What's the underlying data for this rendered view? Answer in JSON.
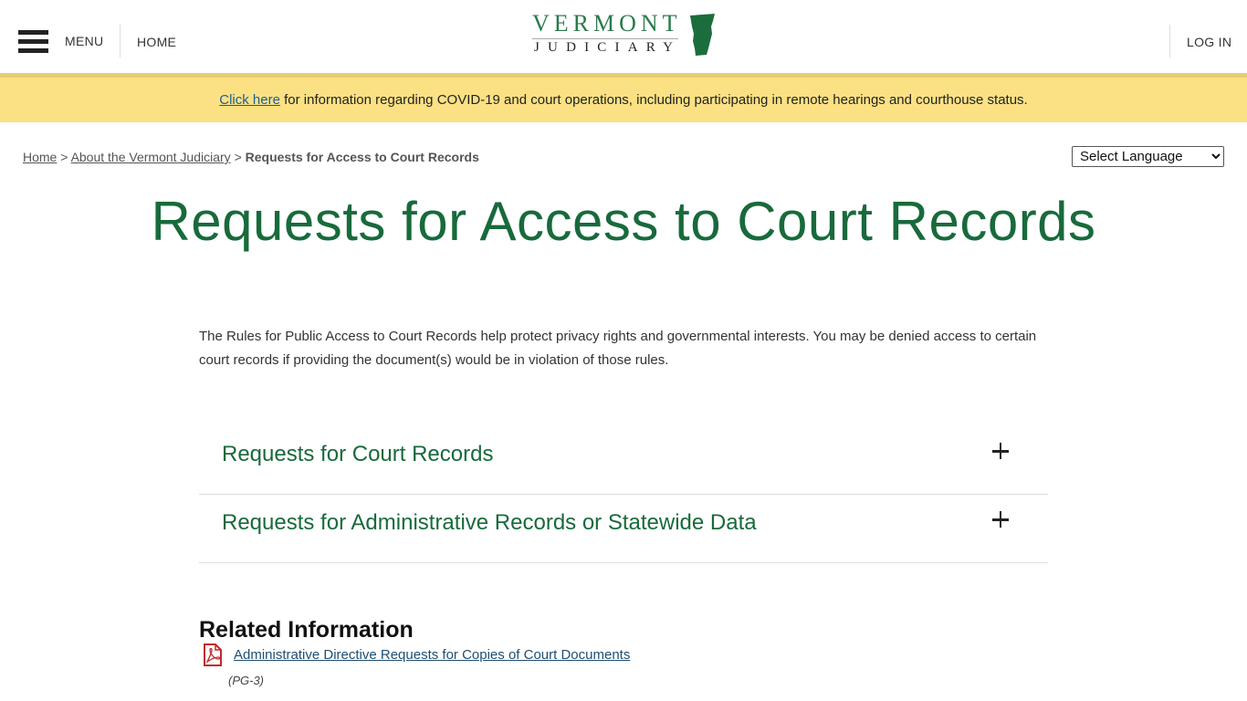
{
  "header": {
    "menu_label": "MENU",
    "home_label": "HOME",
    "login_label": "LOG IN",
    "logo": {
      "line1": "VERMONT",
      "line2": "JUDICIARY",
      "brand_color": "#2a7a4c"
    }
  },
  "banner": {
    "link_text": "Click here",
    "text": " for information regarding COVID-19 and court operations, including participating in remote hearings and courthouse status.",
    "background_color": "#fbe184"
  },
  "breadcrumb": {
    "items": [
      {
        "label": "Home",
        "link": true
      },
      {
        "label": "About the Vermont Judiciary",
        "link": true
      },
      {
        "label": "Requests for Access to Court Records",
        "link": false
      }
    ],
    "separator": ">"
  },
  "language_select": {
    "selected": "Select Language"
  },
  "page": {
    "title": "Requests for Access to Court Records",
    "intro": "The Rules for Public Access to Court Records help protect privacy rights and governmental interests. You may be denied access to certain court records if providing the document(s) would be in violation of those rules.",
    "accent_color": "#186a3b"
  },
  "accordions": [
    {
      "title": "Requests for Court Records",
      "icon": "plus-icon"
    },
    {
      "title": "Requests for Administrative Records or Statewide Data",
      "icon": "plus-icon"
    }
  ],
  "related": {
    "heading": "Related Information",
    "items": [
      {
        "icon": "pdf-icon",
        "label": "Administrative Directive Requests for Copies of Court Documents",
        "code": "(PG-3)"
      }
    ]
  }
}
